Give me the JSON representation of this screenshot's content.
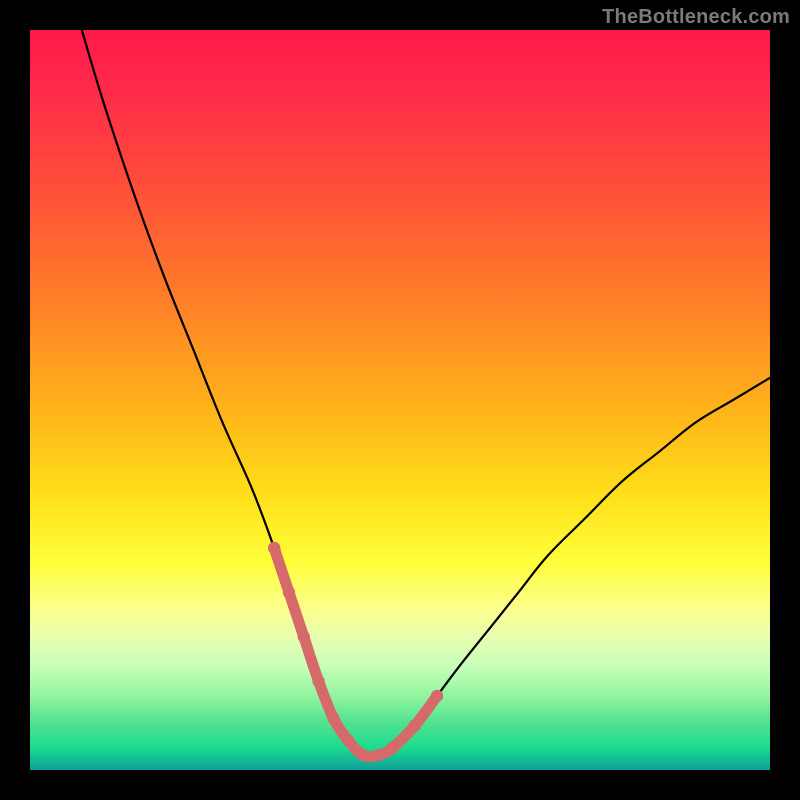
{
  "watermark": "TheBottleneck.com",
  "colors": {
    "background": "#000000",
    "gradient_top": "#ff1a4a",
    "gradient_mid": "#ffe01a",
    "gradient_bottom": "#0e9e9a",
    "curve_stroke": "#000000",
    "highlight_stroke": "#d66a6a"
  },
  "chart_data": {
    "type": "line",
    "title": "",
    "xlabel": "",
    "ylabel": "",
    "xlim": [
      0,
      100
    ],
    "ylim": [
      0,
      100
    ],
    "grid": false,
    "legend": false,
    "annotations": [],
    "series": [
      {
        "name": "curve",
        "x": [
          7,
          10,
          14,
          18,
          22,
          26,
          30,
          33,
          35,
          37,
          39,
          41,
          43,
          45,
          47,
          49,
          52,
          55,
          58,
          62,
          66,
          70,
          75,
          80,
          85,
          90,
          95,
          100
        ],
        "values": [
          100,
          90,
          78,
          67,
          57,
          47,
          38,
          30,
          24,
          18,
          12,
          7,
          4,
          2,
          2,
          3,
          6,
          10,
          14,
          19,
          24,
          29,
          34,
          39,
          43,
          47,
          50,
          53
        ]
      },
      {
        "name": "highlight",
        "x": [
          33,
          35,
          37,
          39,
          41,
          43,
          45,
          47,
          49,
          52,
          55
        ],
        "values": [
          30,
          24,
          18,
          12,
          7,
          4,
          2,
          2,
          3,
          6,
          10
        ]
      }
    ]
  }
}
